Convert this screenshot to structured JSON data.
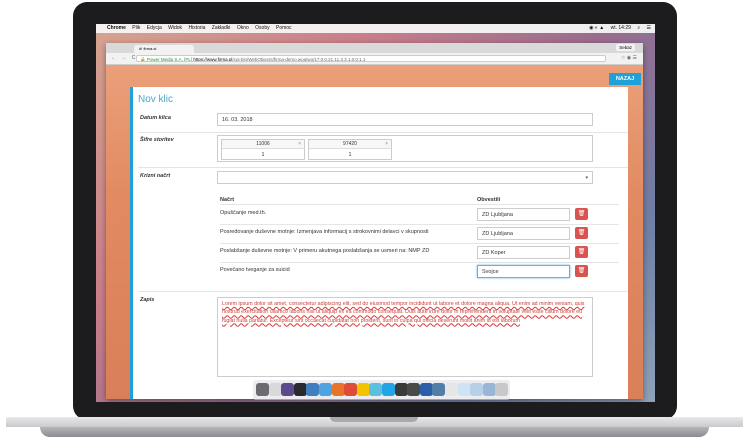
{
  "menubar": {
    "items": [
      "Chrome",
      "Plik",
      "Edycja",
      "Widok",
      "Historia",
      "Zakładki",
      "Okno",
      "Osoby",
      "Pomoc"
    ],
    "time": "wt. 14:29"
  },
  "browser": {
    "tab_title": "#! firma.si",
    "profile": "Sebaz",
    "url_secure": "Power Media S.A. [PL]",
    "url_host": "https://www.firma.pl",
    "url_path": "/cgi-bin/WebObjects/firma-demo.woa/wo/17.0.0.21.11.3.3.1.0.0.1.1",
    "back_nav": "← → C"
  },
  "page": {
    "back_button": "NAZAJ",
    "title": "Nov klic",
    "fields": {
      "datum_label": "Datum klica",
      "datum_value": "16. 03. 2018",
      "sifre_label": "Šifre storitev",
      "sifre": [
        {
          "code": "11006",
          "qty": "1"
        },
        {
          "code": "97420",
          "qty": "1"
        }
      ],
      "krizni_label": "Krizni načrt",
      "zapis_label": "Zapis"
    },
    "table": {
      "col_nacrt": "Načrt",
      "col_obvestili": "Obvestili",
      "rows": [
        {
          "text": "Opuščanje med.th.",
          "obvestili": "ZD Ljubljana"
        },
        {
          "text": "Posredovanje duševne motnje: Izmenjava informacij s strokovnimi delavci v skupnosti",
          "obvestili": "ZD Ljubljana"
        },
        {
          "text": "Poslabšanje duševne motnje: V primeru akutnega poslabšanja se usmeri na: NMP ZD",
          "obvestili": "ZD Koper"
        },
        {
          "text": "Povečano tveganje za suicid",
          "obvestili": "Svojce"
        }
      ]
    },
    "zapis_text": "Lorem ipsum dolor sit amet, consectetur adipiscing elit, sed do eiusmod tempor incididunt ut labore et dolore magna aliqua. Ut enim ad minim veniam, quis nostrud exercitation ullamco laboris nisi ut aliquip ex ea commodo consequat. Duis aute irure dolor in reprehenderit in voluptate velit esse cillum dolore eu fugiat nulla pariatur. Excepteur sint occaecat cupidatat non proident, sunt in culpa qui officia deserunt mollit anim id est laborum"
  },
  "dock_colors": [
    "#6b6b70",
    "#d9d9dc",
    "#5d4a8c",
    "#2a2a2e",
    "#3f7fbf",
    "#4fa3e0",
    "#e8742a",
    "#dd4b39",
    "#f3c200",
    "#5bc0de",
    "#21a5e5",
    "#3a3a3a",
    "#4a4a4a",
    "#2a5ea8",
    "#4f7fa8",
    "#e6e6e6",
    "#cfe3f5",
    "#b8cfe8",
    "#9ab6d6",
    "#c8c8c8"
  ]
}
